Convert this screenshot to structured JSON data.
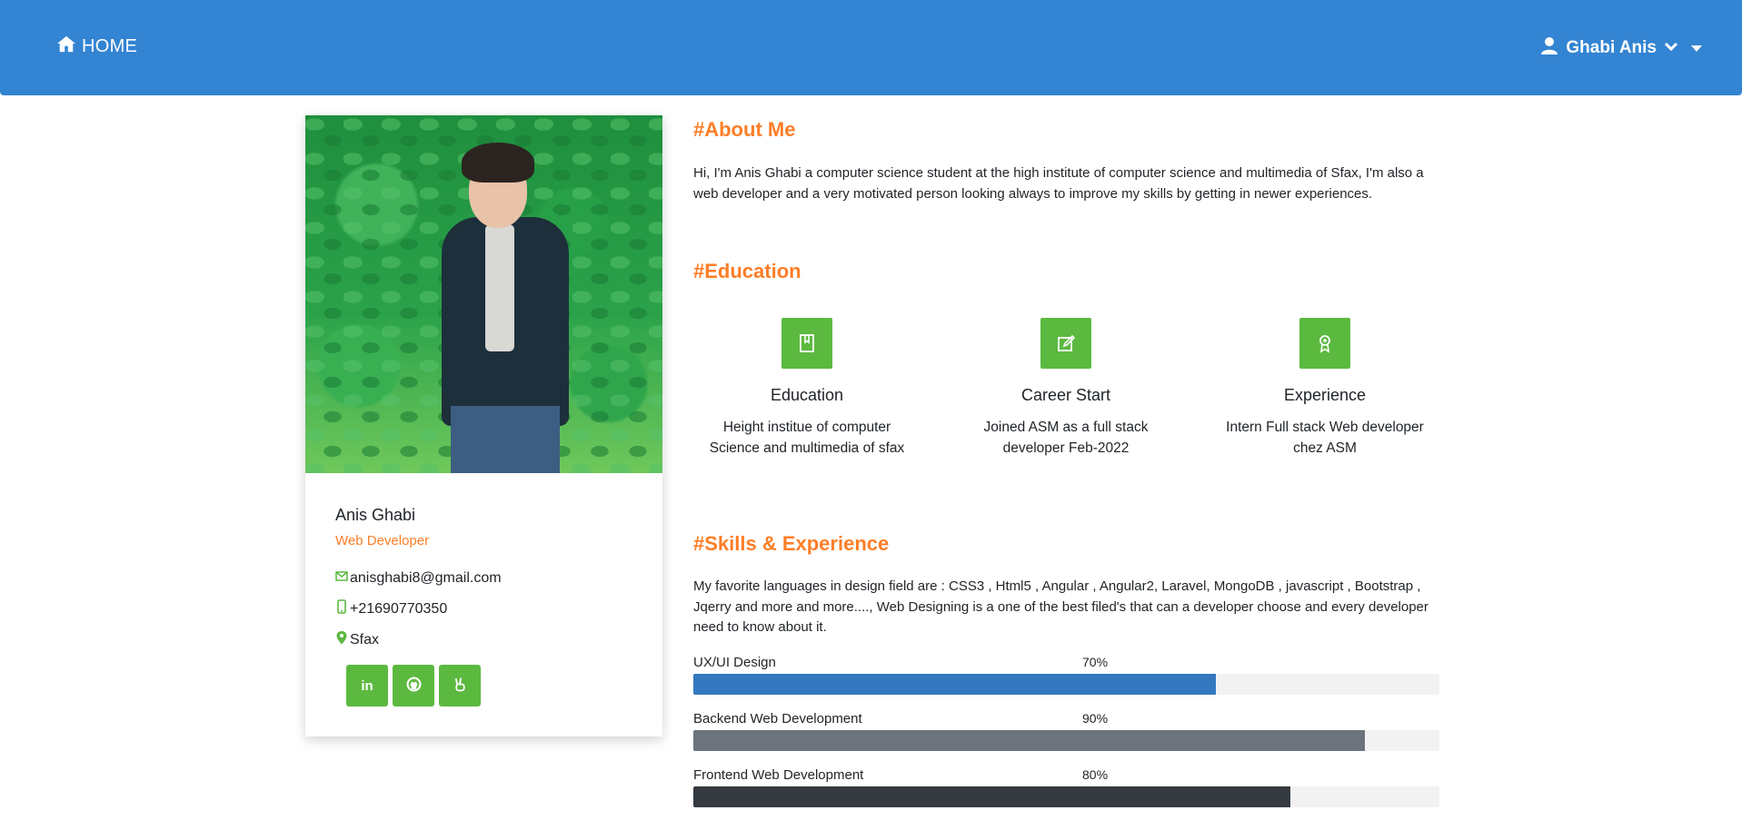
{
  "navbar": {
    "home_label": "HOME",
    "user_name": "Ghabi Anis",
    "background_color": "#3384d2"
  },
  "profile": {
    "name": "Anis Ghabi",
    "role": "Web Developer",
    "email": "anisghabi8@gmail.com",
    "phone": "+21690770350",
    "location": "Sfax",
    "socials": [
      {
        "icon": "linkedin-icon",
        "label": "in"
      },
      {
        "icon": "github-icon",
        "label": ""
      },
      {
        "icon": "peace-hand-icon",
        "label": ""
      }
    ],
    "accent_color": "#fd7e27",
    "icon_color": "#5cb940"
  },
  "about": {
    "title": "#About Me",
    "text": "Hi, I'm Anis Ghabi a computer science student at the high institute of computer science and multimedia of Sfax, I'm also a web developer and a very motivated person looking always to improve my skills by getting in newer experiences."
  },
  "education": {
    "title": "#Education",
    "items": [
      {
        "icon": "book-icon",
        "title": "Education",
        "text": "Height institue of computer Science and multimedia of sfax"
      },
      {
        "icon": "edit-icon",
        "title": "Career Start",
        "text": "Joined ASM as a full stack developer Feb-2022"
      },
      {
        "icon": "award-icon",
        "title": "Experience",
        "text": "Intern Full stack Web developer chez ASM"
      }
    ]
  },
  "skills": {
    "title": "#Skills & Experience",
    "text": "My favorite languages in design field are : CSS3 , Html5 , Angular , Angular2, Laravel, MongoDB , javascript , Bootstrap , Jqerry and more and more...., Web Designing is a one of the best filed's that can a developer choose and every developer need to know about it.",
    "items": [
      {
        "label": "UX/UI Design",
        "percent_label": "70%",
        "value": 0.7,
        "color": "#3378bf"
      },
      {
        "label": "Backend Web Development",
        "percent_label": "90%",
        "value": 0.9,
        "color": "#6c737c"
      },
      {
        "label": "Frontend Web Development",
        "percent_label": "80%",
        "value": 0.8,
        "color": "#343a40"
      }
    ]
  }
}
